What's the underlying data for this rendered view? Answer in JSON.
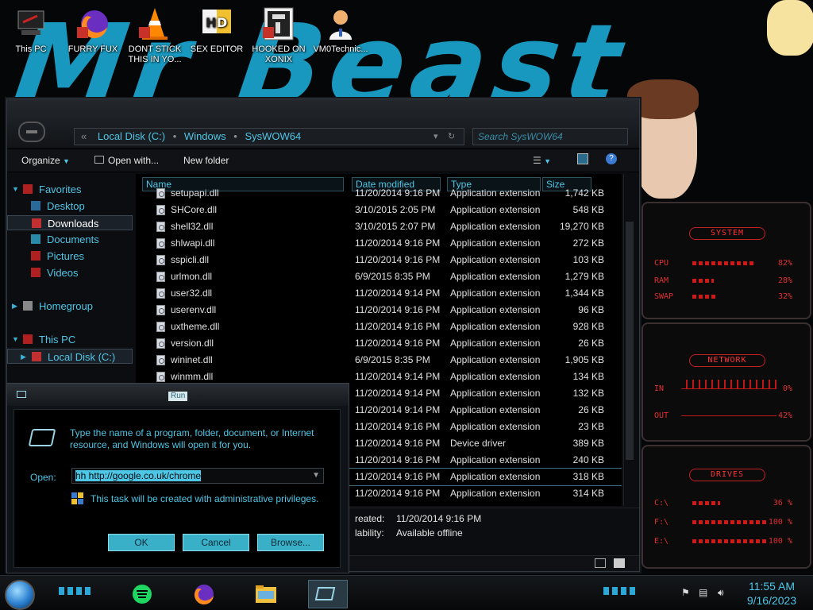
{
  "desktop": {
    "wallpaper_text": "Mr Beast",
    "icons": [
      {
        "label": "This PC",
        "icon": "computer-icon"
      },
      {
        "label": "FURRY FUX",
        "icon": "firefox-icon"
      },
      {
        "label": "DONT STICK THIS IN YO...",
        "icon": "vlc-cone-icon"
      },
      {
        "label": "SEX EDITOR",
        "icon": "hxd-editor-icon"
      },
      {
        "label": "HOOKED ON XONIX",
        "icon": "xonix-game-icon"
      },
      {
        "label": "VM0Technic...",
        "icon": "doctor-avatar-icon"
      }
    ]
  },
  "explorer": {
    "address": {
      "root": "Local Disk (C:)",
      "part1": "Windows",
      "part2": "SysWOW64",
      "back_glyph": "«"
    },
    "search_placeholder": "Search SysWOW64",
    "toolbar": {
      "organize": "Organize",
      "open_with": "Open with...",
      "new_folder": "New folder"
    },
    "nav": {
      "favorites": "Favorites",
      "desktop": "Desktop",
      "downloads": "Downloads",
      "documents": "Documents",
      "pictures": "Pictures",
      "videos": "Videos",
      "homegroup": "Homegroup",
      "this_pc": "This PC",
      "local_disk": "Local Disk (C:)"
    },
    "columns": {
      "name": "Name",
      "date": "Date modified",
      "type": "Type",
      "size": "Size"
    },
    "files": [
      {
        "name": "setupapi.dll",
        "date": "11/20/2014 9:16 PM",
        "type": "Application extension",
        "size": "1,742 KB"
      },
      {
        "name": "SHCore.dll",
        "date": "3/10/2015 2:05 PM",
        "type": "Application extension",
        "size": "548 KB"
      },
      {
        "name": "shell32.dll",
        "date": "3/10/2015 2:07 PM",
        "type": "Application extension",
        "size": "19,270 KB"
      },
      {
        "name": "shlwapi.dll",
        "date": "11/20/2014 9:16 PM",
        "type": "Application extension",
        "size": "272 KB"
      },
      {
        "name": "sspicli.dll",
        "date": "11/20/2014 9:16 PM",
        "type": "Application extension",
        "size": "103 KB"
      },
      {
        "name": "urlmon.dll",
        "date": "6/9/2015 8:35 PM",
        "type": "Application extension",
        "size": "1,279 KB"
      },
      {
        "name": "user32.dll",
        "date": "11/20/2014 9:14 PM",
        "type": "Application extension",
        "size": "1,344 KB"
      },
      {
        "name": "userenv.dll",
        "date": "11/20/2014 9:16 PM",
        "type": "Application extension",
        "size": "96 KB"
      },
      {
        "name": "uxtheme.dll",
        "date": "11/20/2014 9:16 PM",
        "type": "Application extension",
        "size": "928 KB"
      },
      {
        "name": "version.dll",
        "date": "11/20/2014 9:16 PM",
        "type": "Application extension",
        "size": "26 KB"
      },
      {
        "name": "wininet.dll",
        "date": "6/9/2015 8:35 PM",
        "type": "Application extension",
        "size": "1,905 KB"
      },
      {
        "name": "winmm.dll",
        "date": "11/20/2014 9:14 PM",
        "type": "Application extension",
        "size": "134 KB"
      },
      {
        "name": "",
        "date": "11/20/2014 9:14 PM",
        "type": "Application extension",
        "size": "132 KB"
      },
      {
        "name": "",
        "date": "11/20/2014 9:14 PM",
        "type": "Application extension",
        "size": "26 KB"
      },
      {
        "name": "",
        "date": "11/20/2014 9:16 PM",
        "type": "Application extension",
        "size": "23 KB"
      },
      {
        "name": "",
        "date": "11/20/2014 9:16 PM",
        "type": "Device driver",
        "size": "389 KB"
      },
      {
        "name": "",
        "date": "11/20/2014 9:16 PM",
        "type": "Application extension",
        "size": "240 KB"
      },
      {
        "name": "",
        "date": "11/20/2014 9:16 PM",
        "type": "Application extension",
        "size": "318 KB"
      },
      {
        "name": "",
        "date": "11/20/2014 9:16 PM",
        "type": "Application extension",
        "size": "314 KB"
      }
    ],
    "details": {
      "created_label": "reated:",
      "created_value": "11/20/2014 9:16 PM",
      "availability_label": "lability:",
      "availability_value": "Available offline"
    }
  },
  "run": {
    "title": "Run",
    "description": "Type the name of a program, folder, document, or Internet resource, and Windows will open it for you.",
    "open_label": "Open:",
    "input_value": "hh http://google.co.uk/chrome",
    "admin_note": "This task will be created with administrative privileges.",
    "ok": "OK",
    "cancel": "Cancel",
    "browse": "Browse..."
  },
  "widgets": {
    "system": {
      "title": "SYSTEM",
      "cpu_label": "CPU",
      "cpu_value": "82%",
      "cpu_level": 0.82,
      "ram_label": "RAM",
      "ram_value": "28%",
      "ram_level": 0.28,
      "swap_label": "SWAP",
      "swap_value": "32%",
      "swap_level": 0.32
    },
    "network": {
      "title": "NETWORK",
      "in_label": "IN",
      "in_value": "0%",
      "out_label": "OUT",
      "out_value": "42%"
    },
    "drives": {
      "title": "DRIVES",
      "d1_label": "C:\\",
      "d1_value": "36 %",
      "d1_level": 0.36,
      "d2_label": "F:\\",
      "d2_value": "100 %",
      "d2_level": 1.0,
      "d3_label": "E:\\",
      "d3_value": "100 %",
      "d3_level": 1.0
    }
  },
  "taskbar": {
    "time": "11:55 AM",
    "date": "9/16/2023",
    "accent": "#2aa8d8"
  }
}
